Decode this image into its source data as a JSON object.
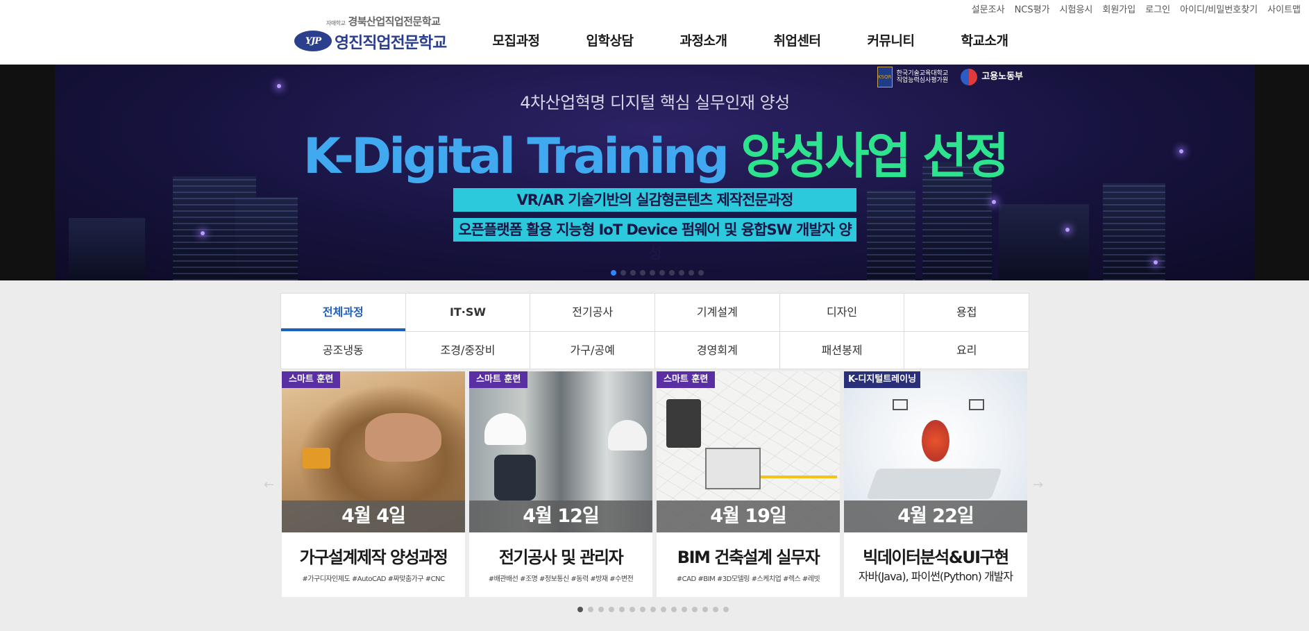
{
  "utility_links": [
    "설문조사",
    "NCS평가",
    "시험응시",
    "회원가입",
    "로그인",
    "아이디/비밀번호찾기",
    "사이트맵"
  ],
  "logo": {
    "prefix": "자매학교",
    "sub": "경북산업직업전문학교",
    "main": "영진직업전문학교",
    "mark": "YJP"
  },
  "nav": [
    "모집과정",
    "입학상담",
    "과정소개",
    "취업센터",
    "커뮤니티",
    "학교소개"
  ],
  "banner": {
    "partners": [
      {
        "line1": "한국기술교육대학교",
        "line2": "직업능력심사평가원",
        "badge": "KSQR"
      },
      {
        "line1": "고용노동부",
        "line2": ""
      }
    ],
    "subtitle": "4차산업혁명 디지털 핵심 실무인재 양성",
    "title_en": "K-Digital Training",
    "title_ko": "양성사업 선정",
    "box1": "VR/AR 기술기반의 실감형콘텐츠 제작전문과정",
    "box2": "오픈플랫폼 활용 지능형 IoT Device 펌웨어 및 융합SW 개발자 양성",
    "slide_count": 10,
    "active_slide": 1
  },
  "tabs": {
    "row1": [
      "전체과정",
      "IT·SW",
      "전기공사",
      "기계설계",
      "디자인",
      "용접"
    ],
    "row2": [
      "공조냉동",
      "조경/중장비",
      "가구/공예",
      "경영회계",
      "패션봉제",
      "요리"
    ],
    "active": "전체과정"
  },
  "cards": [
    {
      "badge": "스마트 훈련",
      "date": "4월 4일",
      "title": "가구설계제작 양성과정",
      "tags": "#가구디자인제도 #AutoCAD #짜맞춤가구 #CNC",
      "sub": ""
    },
    {
      "badge": "스마트 훈련",
      "date": "4월 12일",
      "title": "전기공사 및 관리자",
      "tags": "#배관배선 #조명 #정보통신 #동력 #방재 #수변전",
      "sub": ""
    },
    {
      "badge": "스마트 훈련",
      "date": "4월 19일",
      "title": "BIM 건축설계 실무자",
      "tags": "#CAD #BIM #3D모델링 #스케치업 #렉스 #레빗",
      "sub": ""
    },
    {
      "badge": "K-디지털트레이닝",
      "date": "4월 22일",
      "title": "빅데이터분석&UI구현",
      "tags": "",
      "sub": "자바(Java), 파이썬(Python) 개발자"
    }
  ],
  "carousel": {
    "prev": "←",
    "next": "→",
    "page_count": 15,
    "active_page": 1
  },
  "colors": {
    "brand": "#2b3f8c",
    "tab_active": "#1d5fbf",
    "badge": "#5b2fa4",
    "banner_en": "#41a9f0",
    "banner_ko": "#2ee38e",
    "banner_box": "#2cc8dc"
  }
}
